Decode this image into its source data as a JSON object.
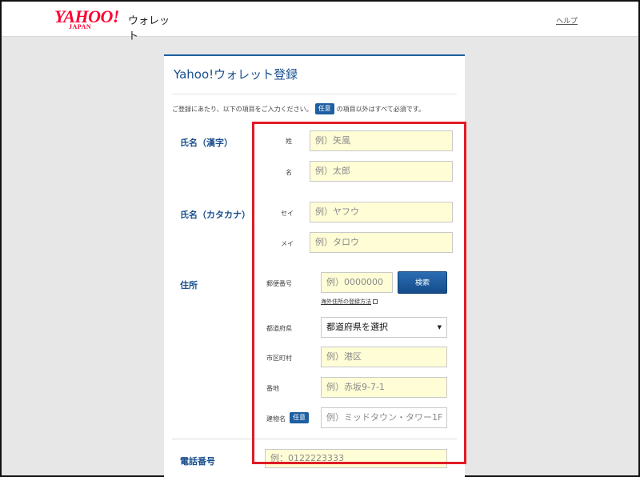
{
  "header": {
    "logo_text": "YAHOO!",
    "logo_sub": "JAPAN",
    "service_name": "ウォレット",
    "help_link": "ヘルプ"
  },
  "page": {
    "title": "Yahoo!ウォレット登録",
    "notice_before": "ご登録にあたり、以下の項目をご入力ください。",
    "notice_badge": "任意",
    "notice_after": "の項目以外はすべて必須です。"
  },
  "name_kanji": {
    "label": "氏名（漢字）",
    "last_label": "姓",
    "last_placeholder": "例）矢風",
    "first_label": "名",
    "first_placeholder": "例）太郎"
  },
  "name_kana": {
    "label": "氏名（カタカナ）",
    "last_label": "セイ",
    "last_placeholder": "例）ヤフウ",
    "first_label": "メイ",
    "first_placeholder": "例）タロウ"
  },
  "address": {
    "label": "住所",
    "postal_label": "郵便番号",
    "postal_placeholder": "例）0000000",
    "search_button": "検索",
    "overseas_link": "海外住所の登録方法",
    "prefecture_label": "都道府県",
    "prefecture_value": "都道府県を選択",
    "city_label": "市区町村",
    "city_placeholder": "例）港区",
    "street_label": "番地",
    "street_placeholder": "例）赤坂9-7-1",
    "building_label": "建物名",
    "building_badge": "任意",
    "building_placeholder": "例）ミッドタウン・タワー1F"
  },
  "phone": {
    "label": "電話番号",
    "placeholder": "例：0122223333"
  },
  "colors": {
    "accent": "#1d5fa0",
    "input_bg": "#fffdd6",
    "highlight": "#e01b24"
  }
}
